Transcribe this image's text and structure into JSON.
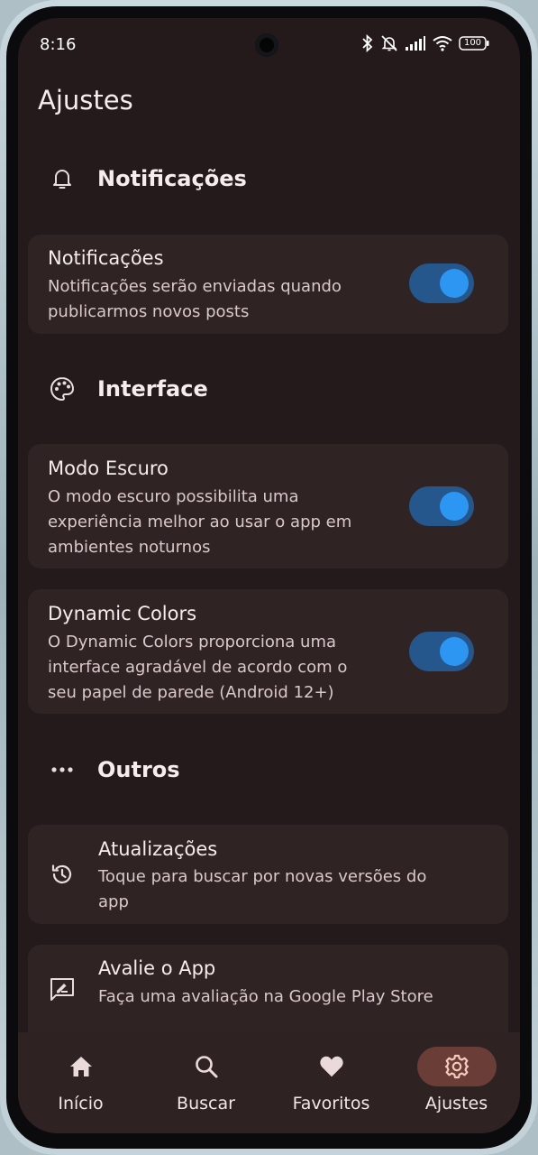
{
  "status_bar": {
    "time": "8:16",
    "battery": "100"
  },
  "page": {
    "title": "Ajustes"
  },
  "sections": {
    "notifications": {
      "header": "Notificações"
    },
    "interface": {
      "header": "Interface"
    },
    "others": {
      "header": "Outros"
    }
  },
  "cards": {
    "notifications": {
      "title": "Notificações",
      "desc_line1": "Notificações serão enviadas quando",
      "desc_line2": "publicarmos novos posts",
      "enabled": true
    },
    "dark_mode": {
      "title": "Modo Escuro",
      "desc_line1": "O modo escuro possibilita uma",
      "desc_line2": "experiência melhor ao usar o app em",
      "desc_line3": "ambientes noturnos",
      "enabled": true
    },
    "dynamic_colors": {
      "title": "Dynamic Colors",
      "desc_line1": "O Dynamic Colors proporciona uma",
      "desc_line2": "interface agradável de acordo com o",
      "desc_line3": "seu papel de parede (Android 12+)",
      "enabled": true
    },
    "updates": {
      "title": "Atualizações",
      "desc_line1": "Toque para buscar por novas versões do",
      "desc_line2": "app"
    },
    "rate": {
      "title": "Avalie o App",
      "desc_line1": "Faça uma avaliação na Google Play Store"
    }
  },
  "bottom_nav": {
    "items": [
      {
        "label": "Início",
        "icon": "home-icon"
      },
      {
        "label": "Buscar",
        "icon": "search-icon"
      },
      {
        "label": "Favoritos",
        "icon": "heart-icon"
      },
      {
        "label": "Ajustes",
        "icon": "gear-icon"
      }
    ],
    "active_index": 3
  },
  "colors": {
    "background": "#241a1b",
    "card": "#302324",
    "toggle_track": "#25578d",
    "toggle_knob": "#2d95f2",
    "nav_active_pill": "#6b3d37"
  }
}
